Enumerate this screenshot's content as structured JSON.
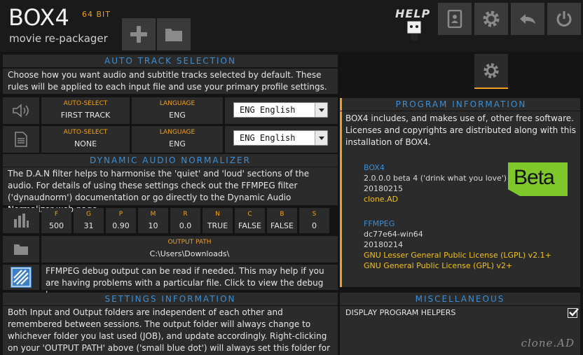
{
  "header": {
    "app_name": "BOX4",
    "bit_label": "64 BIT",
    "subtitle": "movie re-packager",
    "help_label": "HELP"
  },
  "auto_track": {
    "title": "AUTO TRACK SELECTION",
    "description": "Choose how you want audio and subtitle tracks selected by default. These rules will be applied to each input file and use your primary profile settings.",
    "audio": {
      "auto_select_label": "AUTO-SELECT",
      "auto_select_value": "FIRST TRACK",
      "language_label": "LANGUAGE",
      "language_value": "ENG",
      "dropdown_value": "ENG English"
    },
    "subtitle": {
      "auto_select_label": "AUTO-SELECT",
      "auto_select_value": "NONE",
      "language_label": "LANGUAGE",
      "language_value": "ENG",
      "dropdown_value": "ENG English"
    }
  },
  "dan": {
    "title": "DYNAMIC AUDIO NORMALIZER",
    "description": "The D.A.N filter helps to harmonise the 'quiet' and 'loud' sections of the audio. For details of using these settings check out the FFMPEG filter ('dynaudnorm') documentation or go directly to the Dynamic Audio Normalizer web page.",
    "params": [
      {
        "label": "F",
        "value": "500"
      },
      {
        "label": "G",
        "value": "31"
      },
      {
        "label": "P",
        "value": "0.90"
      },
      {
        "label": "M",
        "value": "10"
      },
      {
        "label": "R",
        "value": "0.0"
      },
      {
        "label": "N",
        "value": "TRUE"
      },
      {
        "label": "C",
        "value": "FALSE"
      },
      {
        "label": "B",
        "value": "FALSE"
      },
      {
        "label": "S",
        "value": "0"
      }
    ]
  },
  "output": {
    "label": "OUTPUT PATH",
    "value": "C:\\Users\\Downloads\\"
  },
  "debug": {
    "text": "FFMPEG debug output can be read if needed. This may help if you are having problems with a particular file. Click to view the debug log."
  },
  "settings_info": {
    "title": "SETTINGS INFORMATION",
    "description": "Both Input and Output folders are independent of each other and remembered between sessions. The output folder will always change to whichever folder you last used (JOB), and update accordingly. Right-clicking on your 'OUTPUT PATH' above ('small blue dot') will always set this folder for the jobs (files) you load in."
  },
  "program_info": {
    "title": "PROGRAM INFORMATION",
    "description": "BOX4 includes, and makes use of, other free software. Licenses and copyrights are distributed along with this installation of BOX4.",
    "box4": {
      "name": "BOX4",
      "version": "2.0.0.0 beta 4 ('drink what you love')",
      "date": "20180215",
      "author": "clone.AD"
    },
    "beta_badge": "Beta",
    "ffmpeg": {
      "name": "FFMPEG",
      "version": "dc77e64-win64",
      "date": "20180214",
      "license1": "GNU Lesser General Public License (LGPL) v2.1+",
      "license2": "GNU General Public License (GPL) v2+"
    }
  },
  "misc": {
    "title": "MISCELLANEOUS",
    "option_label": "DISPLAY PROGRAM HELPERS",
    "option_checked": true
  },
  "signature": "clone.AD",
  "colors": {
    "accent_blue": "#3a8fd6",
    "accent_orange": "#f0a020",
    "accent_yellow": "#f0c020",
    "beta_green": "#7ec82a"
  }
}
